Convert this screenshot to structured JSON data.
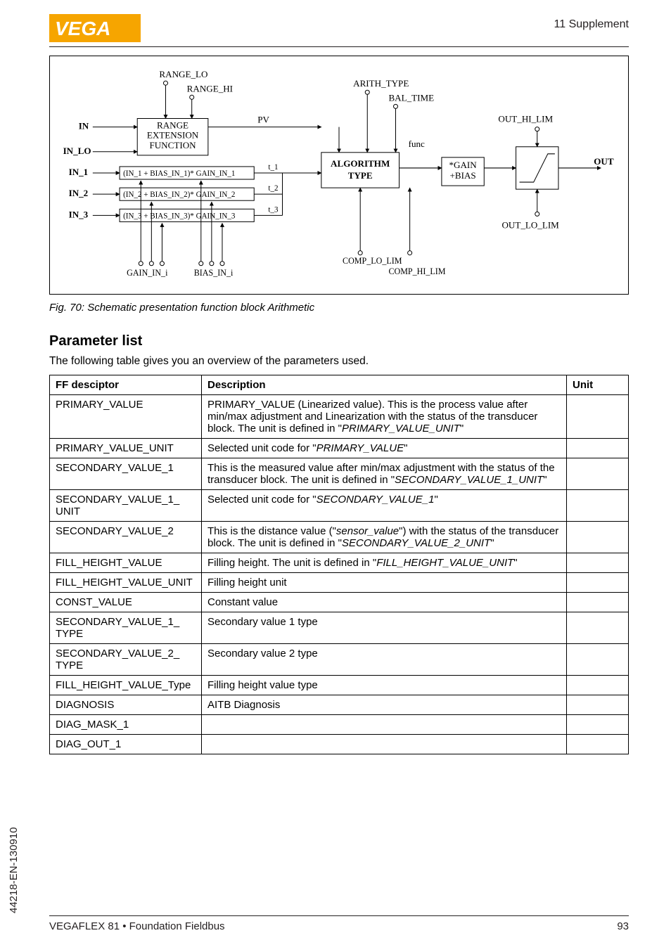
{
  "header": {
    "right": "11 Supplement"
  },
  "caption": "Fig. 70: Schematic presentation function block Arithmetic",
  "section_title": "Parameter list",
  "intro": "The following table gives you an overview of the parameters used.",
  "table": {
    "headers": {
      "ff": "FF desciptor",
      "desc": "Description",
      "unit": "Unit"
    },
    "rows": [
      {
        "ff": "PRIMARY_VALUE",
        "desc_pre": "PRIMARY_VALUE (Linearized value). This is the process value after min/max adjustment and Linearization with the status of the transducer block. The unit is defined in \"",
        "desc_it": "PRIMARY_VALUE_UNIT",
        "desc_post": "\"",
        "unit": ""
      },
      {
        "ff": "PRIMARY_VALUE_UNIT",
        "desc_pre": "Selected unit code for \"",
        "desc_it": "PRIMARY_VALUE",
        "desc_post": "\"",
        "unit": ""
      },
      {
        "ff": "SECONDARY_VALUE_1",
        "desc_pre": "This is the measured value after min/max adjustment with the status of the transducer block. The unit is defined in \"",
        "desc_it": "SECONDARY_VALUE_1_UNIT",
        "desc_post": "\"",
        "unit": ""
      },
      {
        "ff": "SECONDARY_VALUE_1_UNIT",
        "desc_pre": "Selected unit code for \"",
        "desc_it": "SECONDARY_VALUE_1",
        "desc_post": "\"",
        "unit": ""
      },
      {
        "ff": "SECONDARY_VALUE_2",
        "desc_pre": "This is the distance value (\"",
        "desc_it": "sensor_value",
        "desc_mid": "\") with the status of the transducer block. The unit is defined in \"",
        "desc_it2": "SECONDARY_VALUE_2_UNIT",
        "desc_post": "\"",
        "unit": ""
      },
      {
        "ff": "FILL_HEIGHT_VALUE",
        "desc_pre": "Filling height. The unit is defined in \"",
        "desc_it": "FILL_HEIGHT_VALUE_UNIT",
        "desc_post": "\"",
        "unit": ""
      },
      {
        "ff": "FILL_HEIGHT_VALUE_UNIT",
        "desc_pre": "Filling height unit",
        "unit": ""
      },
      {
        "ff": "CONST_VALUE",
        "desc_pre": "Constant value",
        "unit": ""
      },
      {
        "ff": "SECONDARY_VALUE_1_TYPE",
        "desc_pre": "Secondary value 1 type",
        "unit": ""
      },
      {
        "ff": "SECONDARY_VALUE_2_TYPE",
        "desc_pre": "Secondary value 2 type",
        "unit": ""
      },
      {
        "ff": "FILL_HEIGHT_VALUE_Type",
        "desc_pre": "Filling height value type",
        "unit": ""
      },
      {
        "ff": "DIAGNOSIS",
        "desc_pre": "AITB Diagnosis",
        "unit": ""
      },
      {
        "ff": "DIAG_MASK_1",
        "desc_pre": "",
        "unit": ""
      },
      {
        "ff": "DIAG_OUT_1",
        "desc_pre": "",
        "unit": ""
      }
    ]
  },
  "sideways": "44218-EN-130910",
  "footer": {
    "left": "VEGAFLEX 81 • Foundation Fieldbus",
    "right": "93"
  },
  "diagram": {
    "labels": {
      "range_lo": "RANGE_LO",
      "range_hi": "RANGE_HI",
      "arith_type": "ARITH_TYPE",
      "bal_time": "BAL_TIME",
      "out_hi_lim": "OUT_HI_LIM",
      "out_lo_lim": "OUT_LO_LIM",
      "range_ext_func": "RANGE\nEXTENSION\nFUNCTION",
      "algorithm_type": "ALGORITHM\nTYPE",
      "gain_bias": "*GAIN\n+BIAS",
      "func": "func",
      "in": "IN",
      "in_lo": "IN_LO",
      "in1": "IN_1",
      "in2": "IN_2",
      "in3": "IN_3",
      "out": "OUT",
      "pv": "PV",
      "gain_in_i": "GAIN_IN_i",
      "bias_in_i": "BIAS_IN_i",
      "comp_lo_lim": "COMP_LO_LIM",
      "comp_hi_lim": "COMP_HI_LIM",
      "t1": "t_1",
      "t2": "t_2",
      "t3": "t_3",
      "eq1": "(IN_1 + BIAS_IN_1)* GAIN_IN_1",
      "eq2": "(IN_2 + BIAS_IN_2)* GAIN_IN_2",
      "eq3": "(IN_3 + BIAS_IN_3)* GAIN_IN_3"
    }
  }
}
